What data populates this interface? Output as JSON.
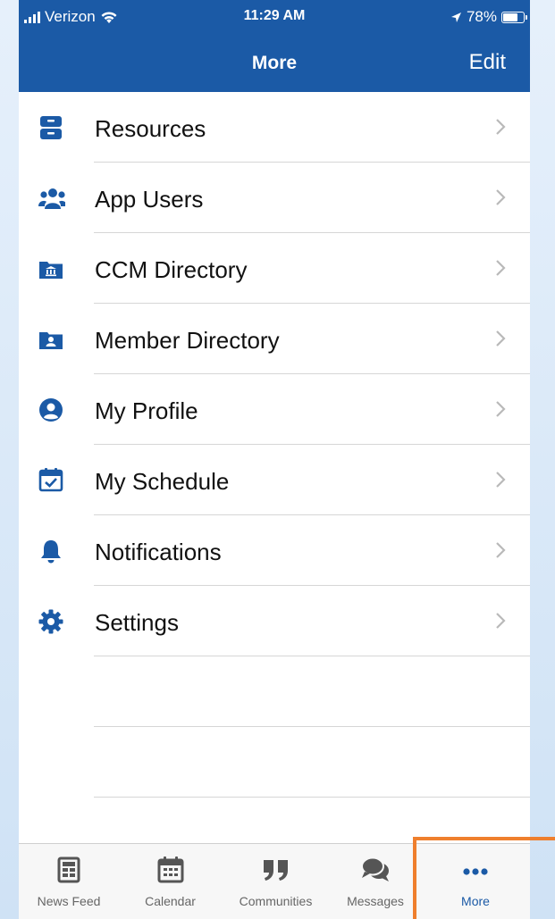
{
  "status_bar": {
    "carrier": "Verizon",
    "time": "11:29 AM",
    "battery": "78%",
    "battery_level": 0.78
  },
  "nav": {
    "title": "More",
    "edit_label": "Edit"
  },
  "menu": {
    "items": [
      {
        "label": "Resources",
        "icon": "archive-icon"
      },
      {
        "label": "App Users",
        "icon": "users-icon"
      },
      {
        "label": "CCM Directory",
        "icon": "folder-building-icon"
      },
      {
        "label": "Member Directory",
        "icon": "folder-contact-icon"
      },
      {
        "label": "My Profile",
        "icon": "user-circle-icon"
      },
      {
        "label": "My Schedule",
        "icon": "calendar-check-icon"
      },
      {
        "label": "Notifications",
        "icon": "bell-icon"
      },
      {
        "label": "Settings",
        "icon": "gear-icon"
      }
    ]
  },
  "tabs": [
    {
      "label": "News Feed",
      "icon": "newspaper-icon"
    },
    {
      "label": "Calendar",
      "icon": "calendar-icon"
    },
    {
      "label": "Communities",
      "icon": "quote-icon"
    },
    {
      "label": "Messages",
      "icon": "chat-bubbles-icon"
    },
    {
      "label": "More",
      "icon": "more-dots-icon",
      "active": true
    }
  ],
  "colors": {
    "brand": "#1b5aa6",
    "highlight": "#ef7f2d"
  }
}
